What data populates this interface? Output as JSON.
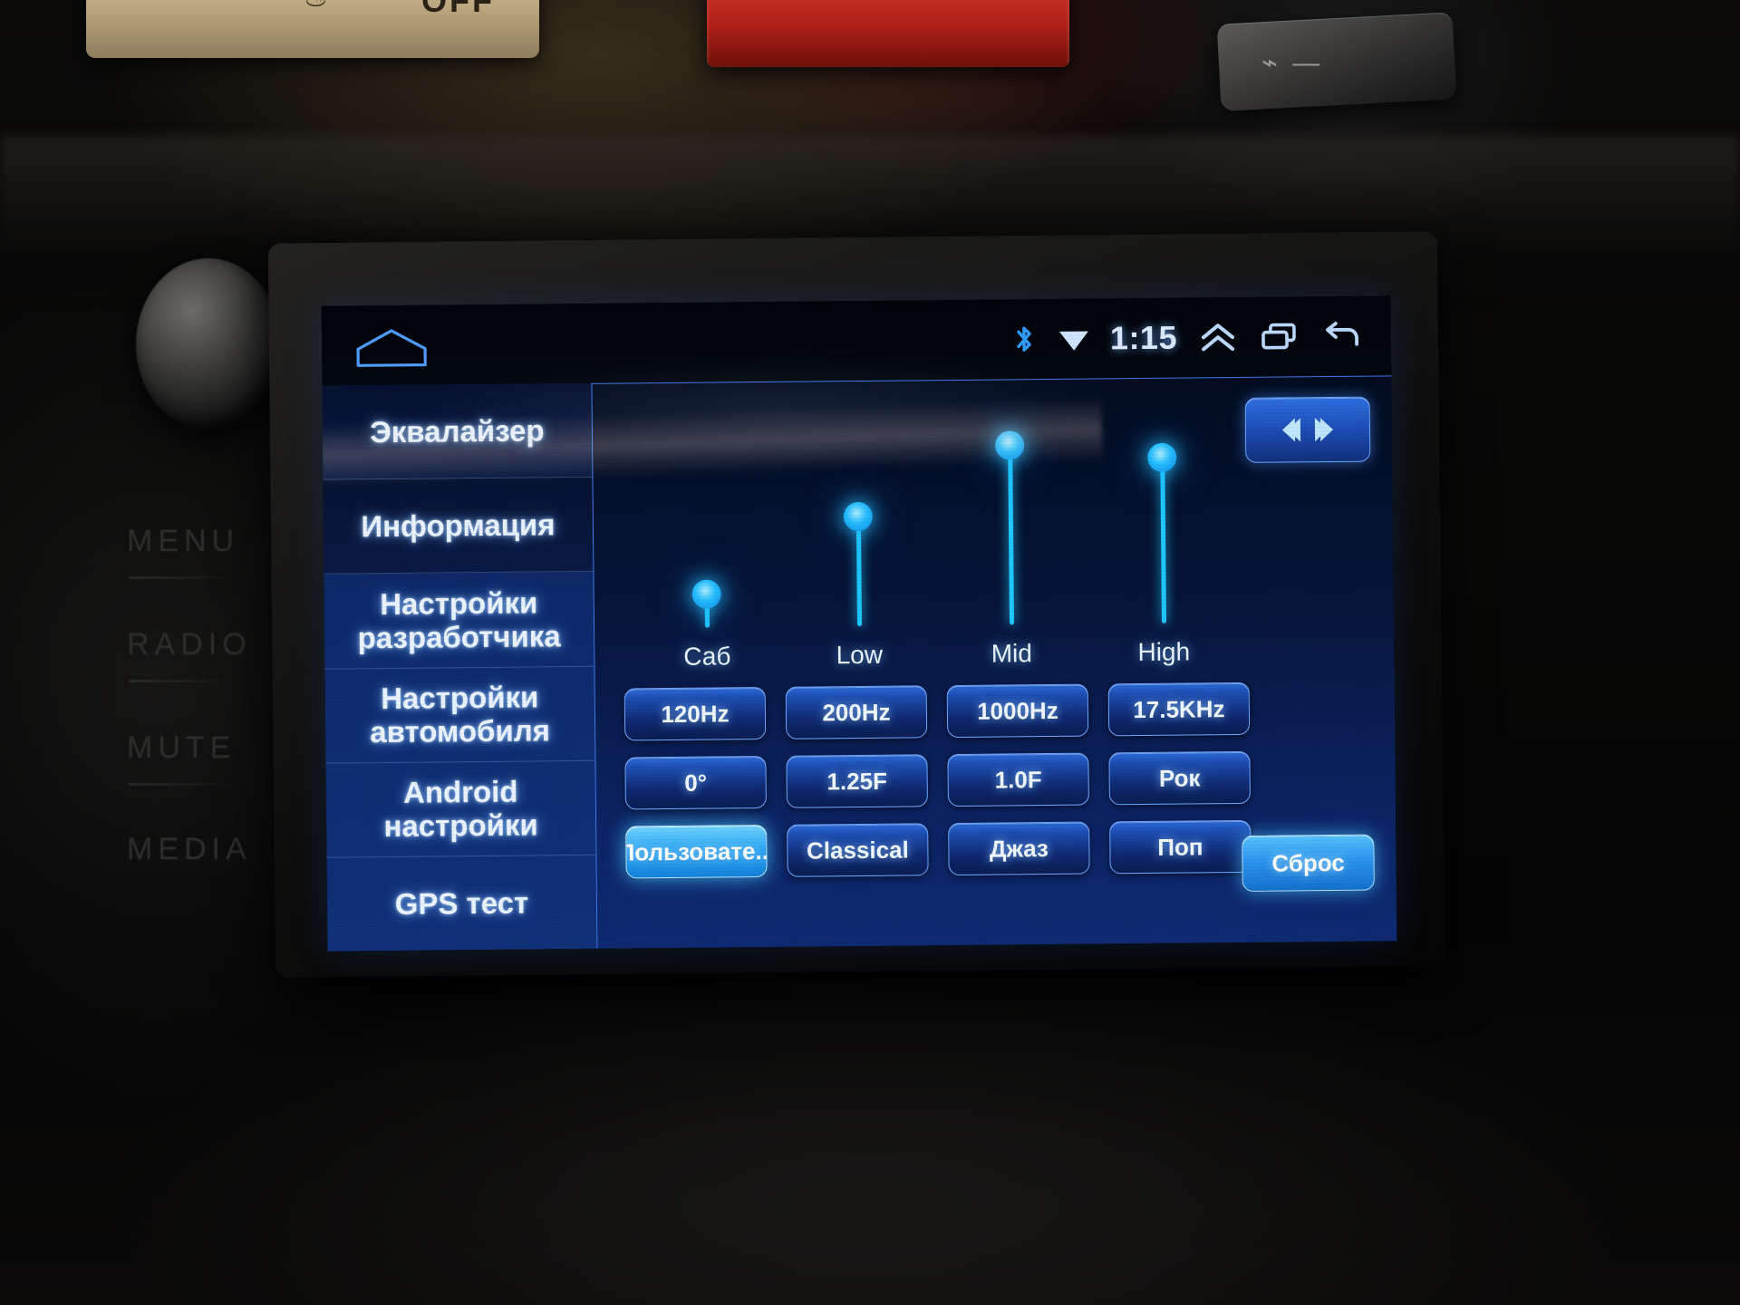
{
  "device": {
    "dashboard_buttons": {
      "off_label": "OFF",
      "off_glyph": "♨",
      "wiper_glyph": "⌁ —"
    },
    "side_labels": [
      "MENU",
      "RADIO",
      "MUTE",
      "MEDIA"
    ]
  },
  "statusbar": {
    "home_icon": "home-outline-icon",
    "bluetooth_icon": "bluetooth-icon",
    "wifi_icon": "wifi-icon",
    "clock": "1:15",
    "expand_icon": "double-chevron-up-icon",
    "recents_icon": "recent-apps-icon",
    "back_icon": "back-arrow-icon"
  },
  "sidebar": {
    "items": [
      {
        "label": "Эквалайзер",
        "selected": true
      },
      {
        "label": "Информация",
        "selected": false
      },
      {
        "label": "Настройки\nразработчика",
        "selected": false
      },
      {
        "label": "Настройки\nавтомобиля",
        "selected": false
      },
      {
        "label": "Android\nнастройки",
        "selected": false
      },
      {
        "label": "GPS тест",
        "selected": false
      }
    ]
  },
  "equalizer": {
    "mirror_button": {
      "name": "balance-mirror-button",
      "glyph": "balance-arrows-icon"
    },
    "sliders": [
      {
        "label": "Саб",
        "value": 18
      },
      {
        "label": "Low",
        "value": 58
      },
      {
        "label": "Mid",
        "value": 95
      },
      {
        "label": "High",
        "value": 88
      }
    ],
    "button_rows": [
      [
        {
          "label": "120Hz",
          "active": false
        },
        {
          "label": "200Hz",
          "active": false
        },
        {
          "label": "1000Hz",
          "active": false
        },
        {
          "label": "17.5KHz",
          "active": false
        }
      ],
      [
        {
          "label": "0°",
          "active": false
        },
        {
          "label": "1.25F",
          "active": false
        },
        {
          "label": "1.0F",
          "active": false
        },
        {
          "label": "Рок",
          "active": false
        }
      ],
      [
        {
          "label": "Пользовате...",
          "active": true
        },
        {
          "label": "Classical",
          "active": false
        },
        {
          "label": "Джаз",
          "active": false
        },
        {
          "label": "Поп",
          "active": false
        }
      ]
    ],
    "reset_label": "Сброс"
  },
  "colors": {
    "accent_cyan": "#1ec8ff",
    "panel_blue": "#0e2a72",
    "sidebar_blue": "#103079",
    "button_blue": "#1e4fb5",
    "text": "#eaf3ff"
  }
}
